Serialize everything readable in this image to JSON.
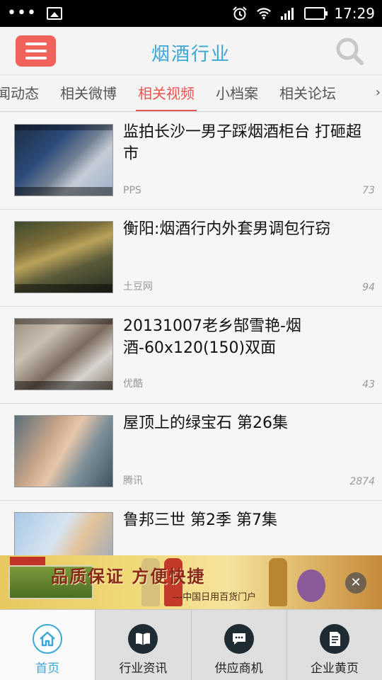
{
  "status_bar": {
    "time": "17:29",
    "icons": [
      "more-dots-icon",
      "image-notification-icon",
      "alarm-icon",
      "wifi-icon",
      "signal-icon",
      "battery-icon"
    ]
  },
  "header": {
    "title": "烟酒行业",
    "menu_icon": "menu-icon",
    "search_icon": "search-icon",
    "accent_color": "#3aa7d8",
    "menu_color": "#f0625a"
  },
  "tabs": {
    "items": [
      "闻动态",
      "相关微博",
      "相关视频",
      "小档案",
      "相关论坛"
    ],
    "active_index": 2,
    "active_color": "#e8554e"
  },
  "videos": [
    {
      "title": "监拍长沙一男子踩烟酒柜台 打砸超市",
      "source": "PPS",
      "count": "73"
    },
    {
      "title": "衡阳:烟酒行内外套男调包行窃",
      "source": "土豆网",
      "count": "94"
    },
    {
      "title": "20131007老乡郜雪艳-烟酒-60x120(150)双面",
      "source": "优酷",
      "count": "43"
    },
    {
      "title": "屋顶上的绿宝石 第26集",
      "source": "腾讯",
      "count": "2874"
    },
    {
      "title": "鲁邦三世 第2季 第7集",
      "source": "",
      "count": ""
    }
  ],
  "ad": {
    "headline": "品质保证 方便快捷",
    "subline": "---中国日用百货门户",
    "close_icon": "close-icon"
  },
  "bottom_nav": {
    "items": [
      {
        "label": "首页",
        "icon": "home-icon"
      },
      {
        "label": "行业资讯",
        "icon": "book-icon"
      },
      {
        "label": "供应商机",
        "icon": "chat-icon"
      },
      {
        "label": "企业黄页",
        "icon": "document-icon"
      }
    ],
    "active_index": 0
  }
}
